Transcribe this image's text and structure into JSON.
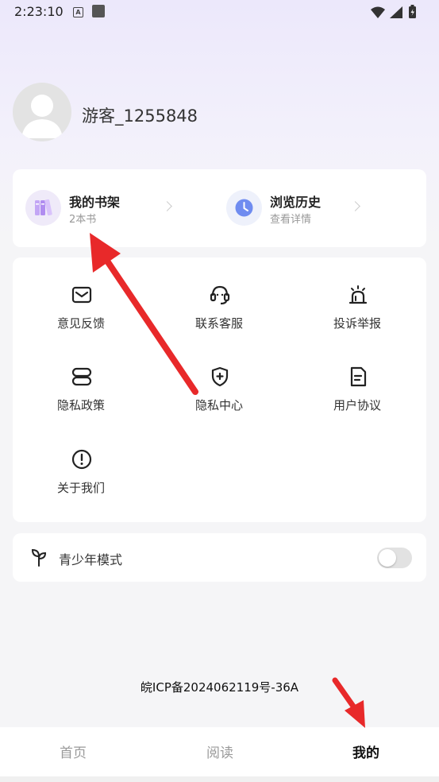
{
  "status_bar": {
    "time": "2:23:10",
    "a_icon": "A"
  },
  "profile": {
    "username": "游客_1255848"
  },
  "shelf": [
    {
      "title": "我的书架",
      "subtitle": "2本书",
      "icon": "books-icon"
    },
    {
      "title": "浏览历史",
      "subtitle": "查看详情",
      "icon": "clock-icon"
    }
  ],
  "grid": [
    {
      "label": "意见反馈",
      "icon": "mail-icon"
    },
    {
      "label": "联系客服",
      "icon": "headset-icon"
    },
    {
      "label": "投诉举报",
      "icon": "siren-icon"
    },
    {
      "label": "隐私政策",
      "icon": "policy-icon"
    },
    {
      "label": "隐私中心",
      "icon": "shield-plus-icon"
    },
    {
      "label": "用户协议",
      "icon": "document-icon"
    },
    {
      "label": "关于我们",
      "icon": "info-icon"
    }
  ],
  "teen_mode": {
    "label": "青少年模式",
    "enabled": false
  },
  "icp": "皖ICP备2024062119号-36A",
  "nav": {
    "tabs": [
      "首页",
      "阅读",
      "我的"
    ],
    "active_index": 2
  },
  "colors": {
    "accent_purple": "#b08cf0",
    "arrow_red": "#e8292a",
    "clock_blue": "#6f8cf0"
  }
}
